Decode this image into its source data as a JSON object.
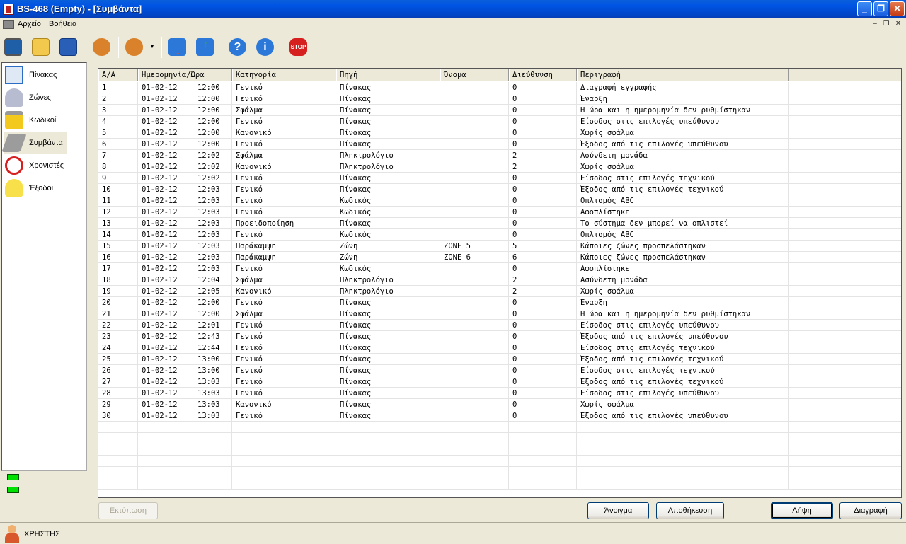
{
  "window": {
    "title": "BS-468 (Empty) - [Συμβάντα]"
  },
  "menu": {
    "items": [
      "Αρχείο",
      "Βοήθεια"
    ]
  },
  "toolbar": {
    "buttons": [
      {
        "name": "monitor-icon",
        "color": "#1f5fa8"
      },
      {
        "name": "open-folder-icon",
        "color": "#f2c94c"
      },
      {
        "name": "save-disk-icon",
        "color": "#2a5fb8"
      },
      {
        "name": "users-icon",
        "color": "#d9822b"
      },
      {
        "name": "user-dropdown-icon",
        "color": "#d9822b"
      },
      {
        "name": "download-icon",
        "color": "#e0562b"
      },
      {
        "name": "upload-icon",
        "color": "#3aa047"
      },
      {
        "name": "help-icon",
        "color": "#2b78d8"
      },
      {
        "name": "info-icon",
        "color": "#2b78d8"
      },
      {
        "name": "stop-icon",
        "color": "#d62020"
      }
    ]
  },
  "sidebar": {
    "items": [
      {
        "label": "Πίνακας",
        "icon": "panel-icon"
      },
      {
        "label": "Ζώνες",
        "icon": "zones-icon"
      },
      {
        "label": "Κωδικοί",
        "icon": "lock-icon"
      },
      {
        "label": "Συμβάντα",
        "icon": "events-icon"
      },
      {
        "label": "Χρονιστές",
        "icon": "alarm-clock-icon"
      },
      {
        "label": "Έξοδοι",
        "icon": "bulb-icon"
      }
    ]
  },
  "user": {
    "label": "ΧΡΗΣΤΗΣ"
  },
  "table": {
    "headers": [
      "Α/Α",
      "Ημερομηνία/Ώρα",
      "Κατηγορία",
      "Πηγή",
      "Όνομα",
      "Διεύθυνση",
      "Περιγραφή"
    ],
    "rows": [
      [
        "1",
        "01-02-12",
        "12:00",
        "Γενικό",
        "Πίνακας",
        "",
        "0",
        "Διαγραφή εγγραφής"
      ],
      [
        "2",
        "01-02-12",
        "12:00",
        "Γενικό",
        "Πίνακας",
        "",
        "0",
        "Έναρξη"
      ],
      [
        "3",
        "01-02-12",
        "12:00",
        "Σφάλμα",
        "Πίνακας",
        "",
        "0",
        "Η ώρα και η ημερομηνία δεν ρυθμίστηκαν"
      ],
      [
        "4",
        "01-02-12",
        "12:00",
        "Γενικό",
        "Πίνακας",
        "",
        "0",
        "Είσοδος στις επιλογές υπεύθυνου"
      ],
      [
        "5",
        "01-02-12",
        "12:00",
        "Κανονικό",
        "Πίνακας",
        "",
        "0",
        "Χωρίς σφάλμα"
      ],
      [
        "6",
        "01-02-12",
        "12:00",
        "Γενικό",
        "Πίνακας",
        "",
        "0",
        "Έξοδος από τις επιλογές υπεύθυνου"
      ],
      [
        "7",
        "01-02-12",
        "12:02",
        "Σφάλμα",
        "Πληκτρολόγιο",
        "",
        "2",
        "Ασύνδετη μονάδα"
      ],
      [
        "8",
        "01-02-12",
        "12:02",
        "Κανονικό",
        "Πληκτρολόγιο",
        "",
        "2",
        "Χωρίς σφάλμα"
      ],
      [
        "9",
        "01-02-12",
        "12:02",
        "Γενικό",
        "Πίνακας",
        "",
        "0",
        "Είσοδος στις επιλογές τεχνικού"
      ],
      [
        "10",
        "01-02-12",
        "12:03",
        "Γενικό",
        "Πίνακας",
        "",
        "0",
        "Έξοδος από τις επιλογές τεχνικού"
      ],
      [
        "11",
        "01-02-12",
        "12:03",
        "Γενικό",
        "Κωδικός",
        "",
        "0",
        "Οπλισμός ABC"
      ],
      [
        "12",
        "01-02-12",
        "12:03",
        "Γενικό",
        "Κωδικός",
        "",
        "0",
        "Αφοπλίστηκε"
      ],
      [
        "13",
        "01-02-12",
        "12:03",
        "Προειδοποίηση",
        "Πίνακας",
        "",
        "0",
        "Το σύστημα δεν μπορεί να οπλιστεί"
      ],
      [
        "14",
        "01-02-12",
        "12:03",
        "Γενικό",
        "Κωδικός",
        "",
        "0",
        "Οπλισμός ABC"
      ],
      [
        "15",
        "01-02-12",
        "12:03",
        "Παράκαμψη",
        "Ζώνη",
        "ZONE 5",
        "5",
        "Κάποιες ζώνες προσπελάστηκαν"
      ],
      [
        "16",
        "01-02-12",
        "12:03",
        "Παράκαμψη",
        "Ζώνη",
        "ZONE 6",
        "6",
        "Κάποιες ζώνες προσπελάστηκαν"
      ],
      [
        "17",
        "01-02-12",
        "12:03",
        "Γενικό",
        "Κωδικός",
        "",
        "0",
        "Αφοπλίστηκε"
      ],
      [
        "18",
        "01-02-12",
        "12:04",
        "Σφάλμα",
        "Πληκτρολόγιο",
        "",
        "2",
        "Ασύνδετη μονάδα"
      ],
      [
        "19",
        "01-02-12",
        "12:05",
        "Κανονικό",
        "Πληκτρολόγιο",
        "",
        "2",
        "Χωρίς σφάλμα"
      ],
      [
        "20",
        "01-02-12",
        "12:00",
        "Γενικό",
        "Πίνακας",
        "",
        "0",
        "Έναρξη"
      ],
      [
        "21",
        "01-02-12",
        "12:00",
        "Σφάλμα",
        "Πίνακας",
        "",
        "0",
        "Η ώρα και η ημερομηνία δεν ρυθμίστηκαν"
      ],
      [
        "22",
        "01-02-12",
        "12:01",
        "Γενικό",
        "Πίνακας",
        "",
        "0",
        "Είσοδος στις επιλογές υπεύθυνου"
      ],
      [
        "23",
        "01-02-12",
        "12:43",
        "Γενικό",
        "Πίνακας",
        "",
        "0",
        "Έξοδος από τις επιλογές υπεύθυνου"
      ],
      [
        "24",
        "01-02-12",
        "12:44",
        "Γενικό",
        "Πίνακας",
        "",
        "0",
        "Είσοδος στις επιλογές τεχνικού"
      ],
      [
        "25",
        "01-02-12",
        "13:00",
        "Γενικό",
        "Πίνακας",
        "",
        "0",
        "Έξοδος από τις επιλογές τεχνικού"
      ],
      [
        "26",
        "01-02-12",
        "13:00",
        "Γενικό",
        "Πίνακας",
        "",
        "0",
        "Είσοδος στις επιλογές τεχνικού"
      ],
      [
        "27",
        "01-02-12",
        "13:03",
        "Γενικό",
        "Πίνακας",
        "",
        "0",
        "Έξοδος από τις επιλογές τεχνικού"
      ],
      [
        "28",
        "01-02-12",
        "13:03",
        "Γενικό",
        "Πίνακας",
        "",
        "0",
        "Είσοδος στις επιλογές υπεύθυνου"
      ],
      [
        "29",
        "01-02-12",
        "13:03",
        "Κανονικό",
        "Πίνακας",
        "",
        "0",
        "Χωρίς σφάλμα"
      ],
      [
        "30",
        "01-02-12",
        "13:03",
        "Γενικό",
        "Πίνακας",
        "",
        "0",
        "Έξοδος από τις επιλογές υπεύθυνου"
      ]
    ]
  },
  "buttons": {
    "print": "Εκτύπωση",
    "open": "Άνοιγμα",
    "save": "Αποθήκευση",
    "receive": "Λήψη",
    "delete": "Διαγραφή"
  }
}
